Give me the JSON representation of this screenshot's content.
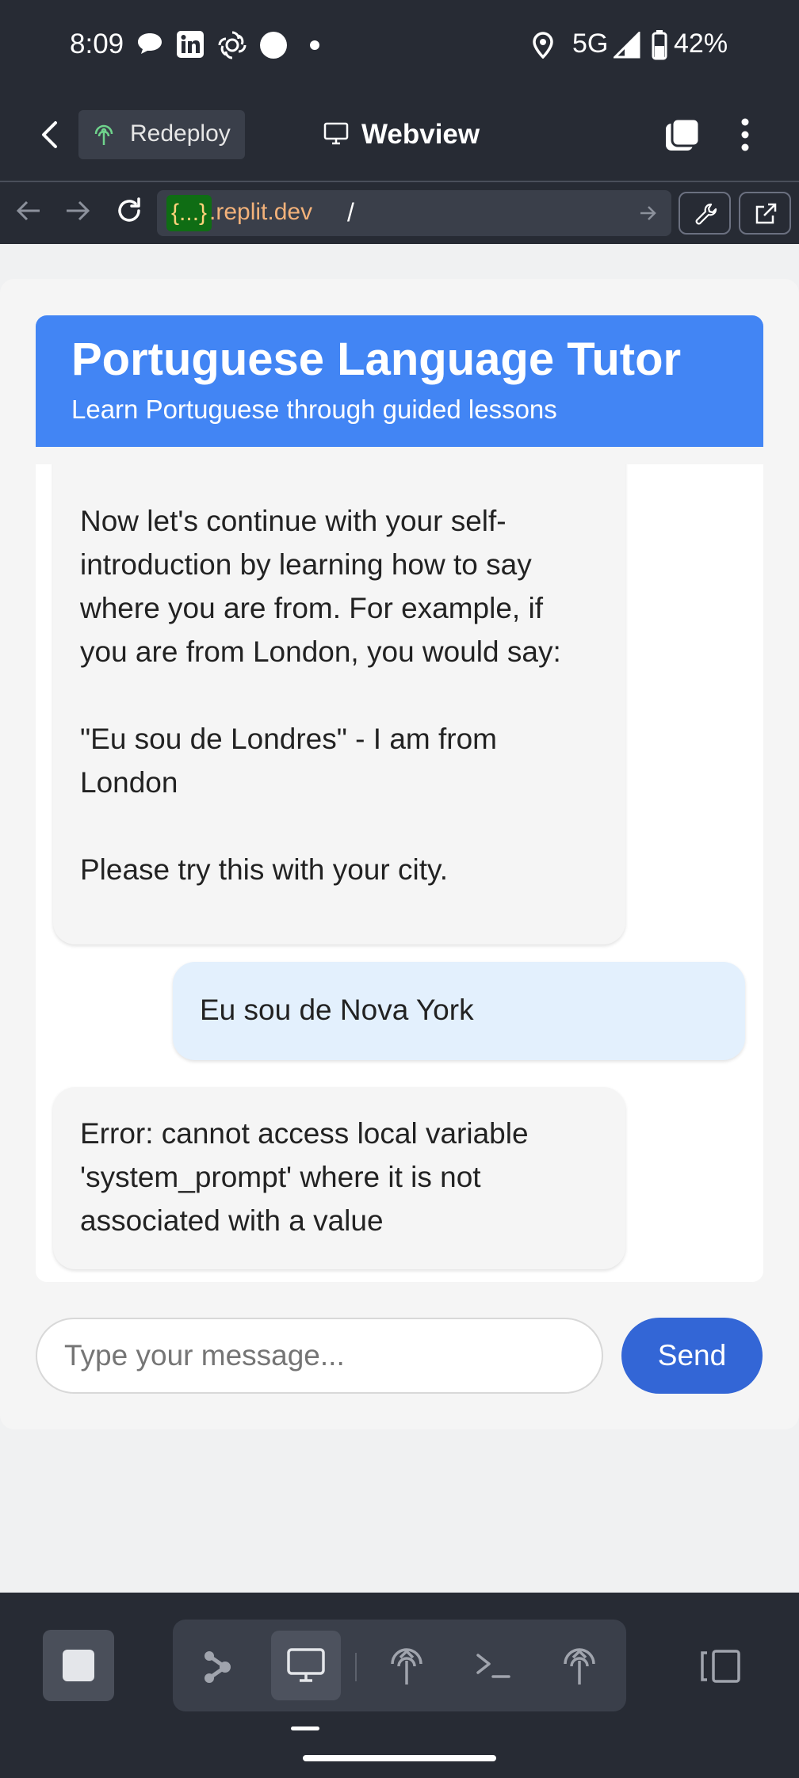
{
  "status_bar": {
    "time": "8:09",
    "network": "5G",
    "battery": "42%",
    "icons": [
      "chat-bubble-icon",
      "linkedin-icon",
      "openai-icon",
      "circle-icon",
      "dot-icon",
      "location-icon",
      "signal-icon",
      "battery-icon"
    ]
  },
  "app_bar": {
    "redeploy_label": "Redeploy",
    "title": "Webview"
  },
  "url_bar": {
    "domain_prefix": "{...}",
    "domain_suffix": ".replit.dev",
    "path": "/"
  },
  "header": {
    "title": "Portuguese Language Tutor",
    "subtitle": "Learn Portuguese through guided lessons"
  },
  "messages": [
    {
      "role": "bot",
      "lines": [
        "Now let's continue with your self-",
        "introduction by learning how to say",
        "where you are from. For example, if",
        "you are from London, you would say:",
        "",
        "\"Eu sou de Londres\" - I am from",
        "London",
        "",
        "Please try this with your city."
      ]
    },
    {
      "role": "user",
      "lines": [
        "Eu sou de Nova York"
      ]
    },
    {
      "role": "bot",
      "lines": [
        "Error: cannot access local variable",
        "'system_prompt' where it is not",
        "associated with a value"
      ]
    }
  ],
  "composer": {
    "placeholder": "Type your message...",
    "send_label": "Send"
  },
  "colors": {
    "header_blue": "#4285f4",
    "send_blue": "#3366d6",
    "user_bubble": "#e3f0fd",
    "bot_bubble": "#f5f5f5",
    "chrome_dark": "#272b34"
  }
}
